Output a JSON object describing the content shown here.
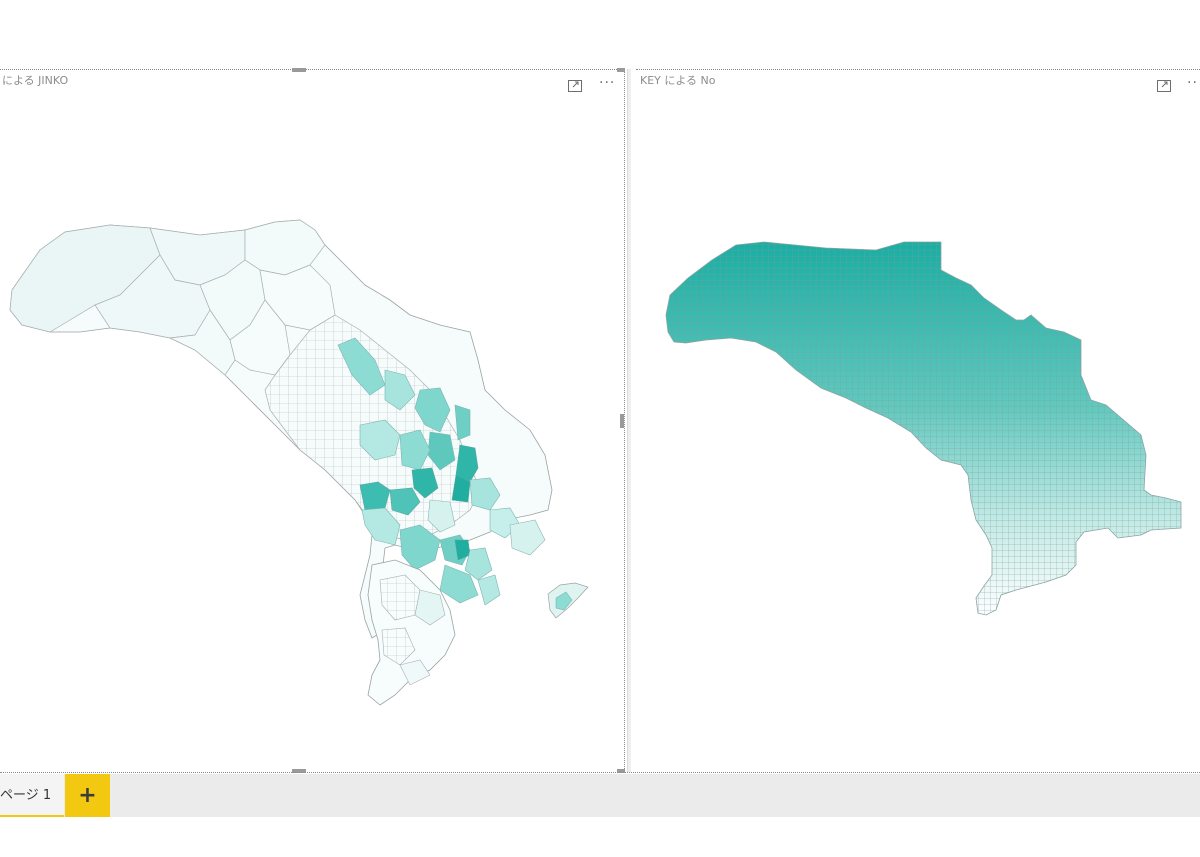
{
  "visuals": {
    "left": {
      "title": "にょる JINKO",
      "title_display": "による JINKO"
    },
    "right": {
      "title": "KEY による No"
    }
  },
  "page_tabs": {
    "current": "ページ 1",
    "add_label": "+"
  },
  "icons": {
    "focus": "focus-mode-icon",
    "more": "more-options-icon"
  },
  "colors": {
    "accent": "#f2c811",
    "map_high": "#1fb2a6",
    "map_low": "#f4fbfb",
    "grid_line": "#9a9a9a"
  }
}
